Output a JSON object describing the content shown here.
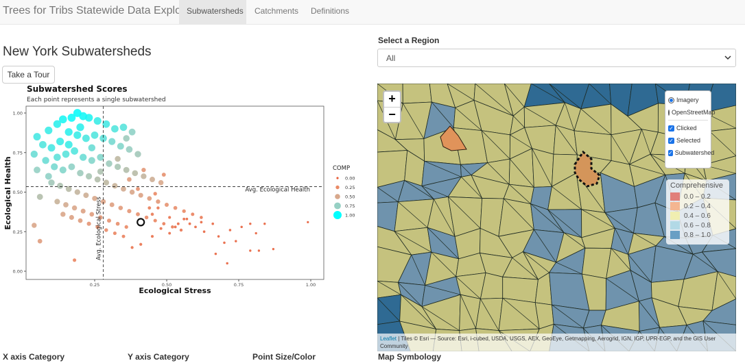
{
  "navbar": {
    "brand": "Trees for Tribs Statewide Data Explorer",
    "tabs": [
      {
        "label": "Subwatersheds",
        "active": true
      },
      {
        "label": "Catchments",
        "active": false
      },
      {
        "label": "Definitions",
        "active": false
      }
    ]
  },
  "main": {
    "title": "New York Subwatersheds",
    "tour_button": "Take a Tour"
  },
  "region": {
    "label": "Select a Region",
    "value": "All"
  },
  "chart_data": {
    "type": "scatter",
    "title": "Subwatershed Scores",
    "subtitle": "Each point represents a single subwatershed",
    "xlabel": "Ecological Stress",
    "ylabel": "Ecological Health",
    "xlim": [
      0,
      1
    ],
    "ylim": [
      0,
      1
    ],
    "xticks": [
      "0.25",
      "0.50",
      "0.75",
      "1.00"
    ],
    "yticks": [
      "0.00",
      "0.25",
      "0.50",
      "0.75",
      "1.00"
    ],
    "ref_lines": {
      "avg_health": 0.535,
      "avg_stress": 0.28,
      "health_label": "Avg. Ecological Health",
      "stress_label": "Avg. Ecological Stress"
    },
    "legend": {
      "title": "COMP",
      "entries": [
        "0.00",
        "0.25",
        "0.50",
        "0.75",
        "1.00"
      ]
    },
    "highlight": {
      "x": 0.41,
      "y": 0.31
    },
    "points": [
      [
        0.19,
        1.0,
        0.98
      ],
      [
        0.21,
        0.98,
        0.96
      ],
      [
        0.17,
        0.97,
        0.97
      ],
      [
        0.23,
        0.97,
        0.94
      ],
      [
        0.14,
        0.96,
        0.95
      ],
      [
        0.26,
        0.95,
        0.9
      ],
      [
        0.29,
        0.93,
        0.88
      ],
      [
        0.35,
        0.91,
        0.85
      ],
      [
        0.32,
        0.9,
        0.86
      ],
      [
        0.12,
        0.93,
        0.92
      ],
      [
        0.09,
        0.89,
        0.9
      ],
      [
        0.05,
        0.85,
        0.88
      ],
      [
        0.07,
        0.8,
        0.86
      ],
      [
        0.1,
        0.78,
        0.88
      ],
      [
        0.13,
        0.82,
        0.9
      ],
      [
        0.16,
        0.88,
        0.92
      ],
      [
        0.19,
        0.86,
        0.9
      ],
      [
        0.22,
        0.84,
        0.87
      ],
      [
        0.25,
        0.86,
        0.86
      ],
      [
        0.28,
        0.84,
        0.84
      ],
      [
        0.31,
        0.82,
        0.8
      ],
      [
        0.34,
        0.79,
        0.78
      ],
      [
        0.37,
        0.77,
        0.74
      ],
      [
        0.4,
        0.74,
        0.7
      ],
      [
        0.12,
        0.72,
        0.84
      ],
      [
        0.15,
        0.74,
        0.85
      ],
      [
        0.18,
        0.76,
        0.86
      ],
      [
        0.21,
        0.72,
        0.82
      ],
      [
        0.24,
        0.7,
        0.78
      ],
      [
        0.27,
        0.72,
        0.78
      ],
      [
        0.3,
        0.68,
        0.72
      ],
      [
        0.33,
        0.66,
        0.68
      ],
      [
        0.36,
        0.64,
        0.64
      ],
      [
        0.39,
        0.62,
        0.62
      ],
      [
        0.42,
        0.6,
        0.58
      ],
      [
        0.45,
        0.58,
        0.54
      ],
      [
        0.48,
        0.56,
        0.5
      ],
      [
        0.11,
        0.66,
        0.8
      ],
      [
        0.14,
        0.64,
        0.78
      ],
      [
        0.17,
        0.66,
        0.76
      ],
      [
        0.2,
        0.62,
        0.72
      ],
      [
        0.23,
        0.6,
        0.68
      ],
      [
        0.26,
        0.58,
        0.64
      ],
      [
        0.29,
        0.56,
        0.6
      ],
      [
        0.32,
        0.54,
        0.56
      ],
      [
        0.35,
        0.52,
        0.52
      ],
      [
        0.38,
        0.5,
        0.48
      ],
      [
        0.41,
        0.48,
        0.44
      ],
      [
        0.44,
        0.46,
        0.4
      ],
      [
        0.47,
        0.44,
        0.36
      ],
      [
        0.5,
        0.42,
        0.32
      ],
      [
        0.53,
        0.4,
        0.28
      ],
      [
        0.56,
        0.38,
        0.24
      ],
      [
        0.59,
        0.36,
        0.2
      ],
      [
        0.62,
        0.34,
        0.16
      ],
      [
        0.1,
        0.56,
        0.7
      ],
      [
        0.13,
        0.54,
        0.66
      ],
      [
        0.16,
        0.52,
        0.62
      ],
      [
        0.19,
        0.5,
        0.58
      ],
      [
        0.22,
        0.48,
        0.54
      ],
      [
        0.25,
        0.46,
        0.5
      ],
      [
        0.28,
        0.44,
        0.46
      ],
      [
        0.31,
        0.42,
        0.42
      ],
      [
        0.34,
        0.4,
        0.38
      ],
      [
        0.37,
        0.38,
        0.34
      ],
      [
        0.4,
        0.36,
        0.3
      ],
      [
        0.43,
        0.34,
        0.26
      ],
      [
        0.46,
        0.32,
        0.22
      ],
      [
        0.49,
        0.3,
        0.18
      ],
      [
        0.52,
        0.28,
        0.16
      ],
      [
        0.55,
        0.26,
        0.14
      ],
      [
        0.12,
        0.44,
        0.56
      ],
      [
        0.15,
        0.42,
        0.52
      ],
      [
        0.18,
        0.4,
        0.48
      ],
      [
        0.21,
        0.38,
        0.44
      ],
      [
        0.24,
        0.36,
        0.4
      ],
      [
        0.27,
        0.34,
        0.36
      ],
      [
        0.3,
        0.32,
        0.32
      ],
      [
        0.33,
        0.3,
        0.28
      ],
      [
        0.36,
        0.28,
        0.24
      ],
      [
        0.14,
        0.36,
        0.48
      ],
      [
        0.17,
        0.34,
        0.44
      ],
      [
        0.2,
        0.32,
        0.4
      ],
      [
        0.23,
        0.3,
        0.34
      ],
      [
        0.26,
        0.28,
        0.3
      ],
      [
        0.29,
        0.26,
        0.26
      ],
      [
        0.32,
        0.24,
        0.22
      ],
      [
        0.35,
        0.22,
        0.2
      ],
      [
        0.05,
        0.64,
        0.75
      ],
      [
        0.04,
        0.74,
        0.82
      ],
      [
        0.06,
        0.47,
        0.64
      ],
      [
        0.04,
        0.29,
        0.48
      ],
      [
        0.06,
        0.19,
        0.4
      ],
      [
        0.18,
        0.07,
        0.22
      ],
      [
        0.38,
        0.15,
        0.12
      ],
      [
        0.41,
        0.17,
        0.12
      ],
      [
        0.45,
        0.22,
        0.1
      ],
      [
        0.48,
        0.27,
        0.1
      ],
      [
        0.51,
        0.24,
        0.08
      ],
      [
        0.54,
        0.3,
        0.08
      ],
      [
        0.57,
        0.33,
        0.06
      ],
      [
        0.6,
        0.28,
        0.06
      ],
      [
        0.63,
        0.25,
        0.05
      ],
      [
        0.66,
        0.3,
        0.05
      ],
      [
        0.68,
        0.22,
        0.04
      ],
      [
        0.7,
        0.18,
        0.04
      ],
      [
        0.72,
        0.26,
        0.04
      ],
      [
        0.74,
        0.19,
        0.03
      ],
      [
        0.76,
        0.28,
        0.03
      ],
      [
        0.79,
        0.3,
        0.03
      ],
      [
        0.81,
        0.24,
        0.02
      ],
      [
        0.84,
        0.3,
        0.02
      ],
      [
        0.67,
        0.11,
        0.04
      ],
      [
        0.71,
        0.05,
        0.03
      ],
      [
        0.79,
        0.13,
        0.02
      ],
      [
        0.82,
        0.13,
        0.02
      ],
      [
        0.87,
        0.14,
        0.02
      ],
      [
        0.99,
        0.31,
        0.0
      ],
      [
        0.51,
        0.34,
        0.1
      ],
      [
        0.53,
        0.28,
        0.08
      ],
      [
        0.44,
        0.4,
        0.18
      ],
      [
        0.46,
        0.49,
        0.24
      ],
      [
        0.49,
        0.61,
        0.3
      ],
      [
        0.42,
        0.64,
        0.36
      ],
      [
        0.4,
        0.52,
        0.3
      ],
      [
        0.37,
        0.58,
        0.4
      ],
      [
        0.33,
        0.71,
        0.6
      ],
      [
        0.36,
        0.84,
        0.72
      ],
      [
        0.38,
        0.88,
        0.76
      ],
      [
        0.45,
        0.36,
        0.16
      ],
      [
        0.47,
        0.4,
        0.14
      ],
      [
        0.56,
        0.33,
        0.08
      ],
      [
        0.58,
        0.3,
        0.07
      ],
      [
        0.62,
        0.31,
        0.06
      ],
      [
        0.27,
        0.63,
        0.66
      ],
      [
        0.24,
        0.78,
        0.82
      ],
      [
        0.2,
        0.91,
        0.92
      ],
      [
        0.16,
        0.8,
        0.9
      ],
      [
        0.09,
        0.6,
        0.76
      ],
      [
        0.08,
        0.7,
        0.82
      ]
    ]
  },
  "map": {
    "zoom_in": "+",
    "zoom_out": "−",
    "base_layers": [
      {
        "label": "Imagery",
        "selected": true
      },
      {
        "label": "OpenStreetMap",
        "selected": false
      }
    ],
    "overlays": [
      {
        "label": "Clicked",
        "checked": true
      },
      {
        "label": "Selected",
        "checked": true
      },
      {
        "label": "Subwatershed",
        "checked": true
      }
    ],
    "legend": {
      "title": "Comprehensive",
      "items": [
        {
          "label": "0.0 – 0.2",
          "color": "#e17f7a"
        },
        {
          "label": "0.2 – 0.4",
          "color": "#f4b691"
        },
        {
          "label": "0.4 – 0.6",
          "color": "#f0eeb1"
        },
        {
          "label": "0.6 – 0.8",
          "color": "#b2d9e6"
        },
        {
          "label": "0.8 – 1.0",
          "color": "#6a9fc4"
        }
      ]
    },
    "attribution": {
      "leaflet": "Leaflet",
      "text": " | Tiles © Esri — Source: Esri, i-cubed, USDA, USGS, AEX, GeoEye, Getmapping, Aerogrid, IGN, IGP, UPR-EGP, and the GIS User Community"
    }
  },
  "bottom": {
    "x_axis": "X axis Category",
    "y_axis": "Y axis Category",
    "point": "Point Size/Color",
    "map_sym": "Map Symbology"
  }
}
